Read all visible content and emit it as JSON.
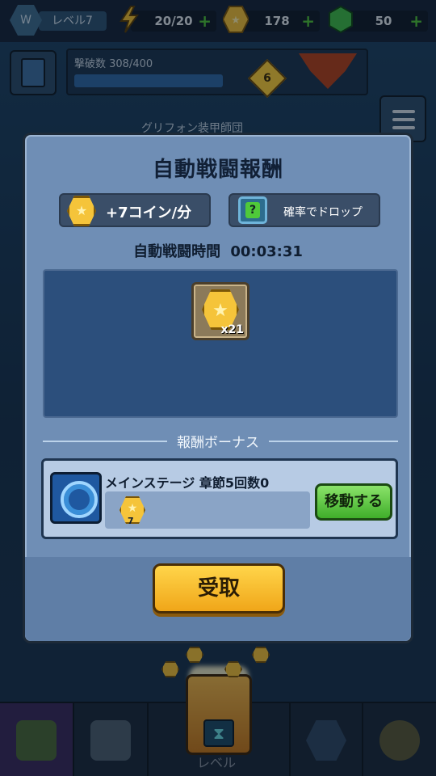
{
  "topbar": {
    "level_label": "レベル7",
    "energy": "20/20",
    "coins": "178",
    "gems": "50"
  },
  "stage": {
    "kills_label": "撃破数 308/400",
    "stage_number": "6"
  },
  "background": {
    "partial_text": "グリフォン装甲師団"
  },
  "modal": {
    "title": "自動戦闘報酬",
    "coin_rate": "+7コイン/分",
    "drop_label": "確率でドロップ",
    "time_label": "自動戦闘時間",
    "time_value": "00:03:31",
    "reward_qty": "x21",
    "bonus_section_label": "報酬ボーナス",
    "bonus_title": "メインステージ 章節5回数0",
    "bonus_reward_qty": "7",
    "go_button": "移動する",
    "receive_button": "受取"
  },
  "bottom_nav": {
    "center_label": "レベル"
  },
  "colors": {
    "modal_bg": "#6f8eb5",
    "receive_button": "#f0a619",
    "go_button": "#3fae2a",
    "coin": "#f5c43a"
  },
  "icons": [
    "level-icon",
    "energy-icon",
    "coin-icon",
    "gem-icon",
    "plus-icon",
    "menu-icon",
    "coin-icon",
    "mystery-box-icon",
    "compass-icon",
    "chest-icon",
    "hourglass-icon"
  ]
}
